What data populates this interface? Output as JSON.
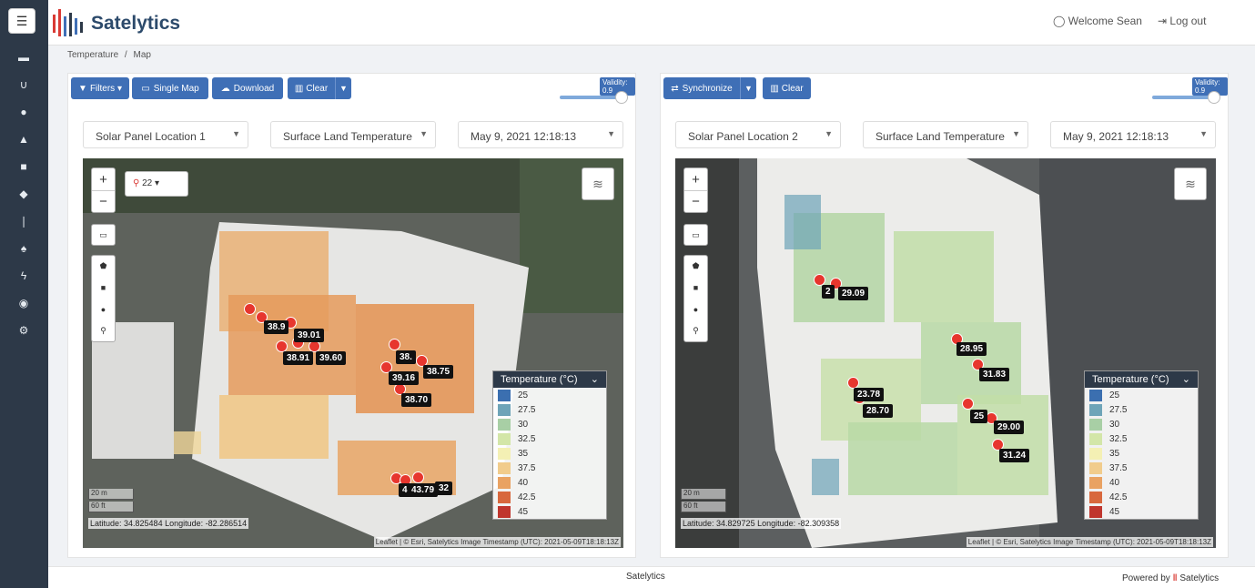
{
  "app": {
    "title": "Satelytics"
  },
  "header": {
    "welcome": "Welcome Sean",
    "logout": "Log out"
  },
  "breadcrumb": {
    "parent": "Temperature",
    "current": "Map"
  },
  "sidebar": {
    "icons": [
      "folder-icon",
      "magnet-icon",
      "drop-icon",
      "warning-icon",
      "lock-icon",
      "leaf-icon",
      "thermometer-icon",
      "tree-icon",
      "bolt-icon",
      "user-icon",
      "network-icon"
    ]
  },
  "left_panel": {
    "buttons": {
      "filters": "Filters ▾",
      "single_map": "Single Map",
      "download": "Download",
      "clear": "Clear"
    },
    "validity": "Validity: 0.9",
    "slider_value": 0.9,
    "location": "Solar Panel Location 1",
    "layer": "Surface Land Temperature",
    "date": "May 9, 2021 12:18:13",
    "pin_zoom": "22",
    "scale": {
      "m": "20 m",
      "ft": "60 ft"
    },
    "coords": "Latitude: 34.825484 Longitude: -82.286514",
    "attribution": "Leaflet | © Esri, Satelytics Image Timestamp (UTC): 2021-05-09T18:18:13Z",
    "labels": [
      "38.9",
      "39.01",
      "38.91",
      "39.60",
      "38.",
      "38.75",
      "39.16",
      "38.70",
      "43.79",
      "4",
      "32"
    ]
  },
  "right_panel": {
    "buttons": {
      "synchronize": "Synchronize",
      "clear": "Clear"
    },
    "validity": "Validity: 0.9",
    "slider_value": 0.9,
    "location": "Solar Panel Location 2",
    "layer": "Surface Land Temperature",
    "date": "May 9, 2021 12:18:13",
    "scale": {
      "m": "20 m",
      "ft": "60 ft"
    },
    "coords": "Latitude: 34.829725 Longitude: -82.309358",
    "attribution": "Leaflet | © Esri, Satelytics Image Timestamp (UTC): 2021-05-09T18:18:13Z",
    "labels": [
      "2",
      "29.09",
      "28.95",
      "31.83",
      "23.78",
      "28.70",
      "25",
      "29.00",
      "31.24"
    ]
  },
  "legend": {
    "title": "Temperature (°C)",
    "items": [
      {
        "label": "25",
        "color": "#3b6fb0"
      },
      {
        "label": "27.5",
        "color": "#6ea4b8"
      },
      {
        "label": "30",
        "color": "#a8cfa5"
      },
      {
        "label": "32.5",
        "color": "#d3e6a8"
      },
      {
        "label": "35",
        "color": "#f4f0b4"
      },
      {
        "label": "37.5",
        "color": "#f1cc8c"
      },
      {
        "label": "40",
        "color": "#e9a262"
      },
      {
        "label": "42.5",
        "color": "#d8683d"
      },
      {
        "label": "45",
        "color": "#c0362e"
      }
    ]
  },
  "footer": {
    "center": "Satelytics",
    "powered": "Powered by",
    "brand": "Satelytics"
  }
}
